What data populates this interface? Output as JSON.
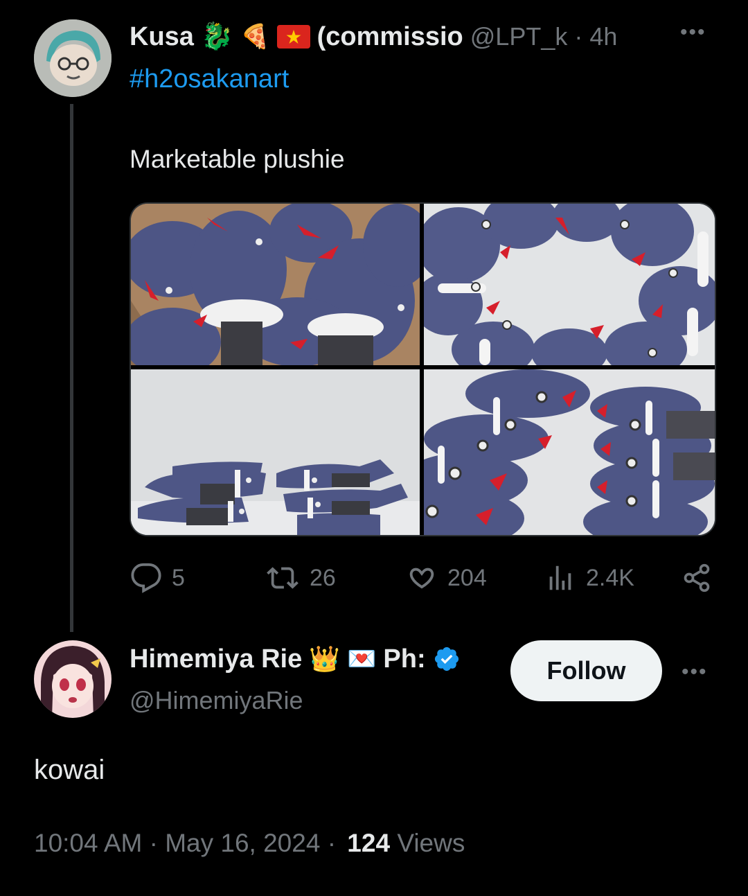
{
  "tweet": {
    "author_name": "Kusa",
    "author_name_suffix": "(commissio",
    "handle": "@LPT_k",
    "separator": "·",
    "time": "4h",
    "hashtag": "#h2osakanart",
    "text": "Marketable plushie",
    "stats": {
      "replies": "5",
      "retweets": "26",
      "likes": "204",
      "views": "2.4K"
    }
  },
  "reply": {
    "author_name": "Himemiya Rie",
    "author_name_suffix": "Ph:",
    "handle": "@HimemiyaRie",
    "follow_label": "Follow",
    "text": "kowai",
    "timestamp": "10:04 AM · May 16, 2024 ·",
    "views_count": "124",
    "views_label": "Views"
  },
  "icons": {
    "more": "more-icon",
    "reply": "reply-icon",
    "retweet": "retweet-icon",
    "like": "heart-icon",
    "views": "views-icon",
    "share": "share-icon",
    "verified": "verified-icon"
  },
  "colors": {
    "link": "#1d9bf0",
    "muted": "#71767b",
    "text": "#e7e9ea",
    "plush": "#4f5788"
  }
}
